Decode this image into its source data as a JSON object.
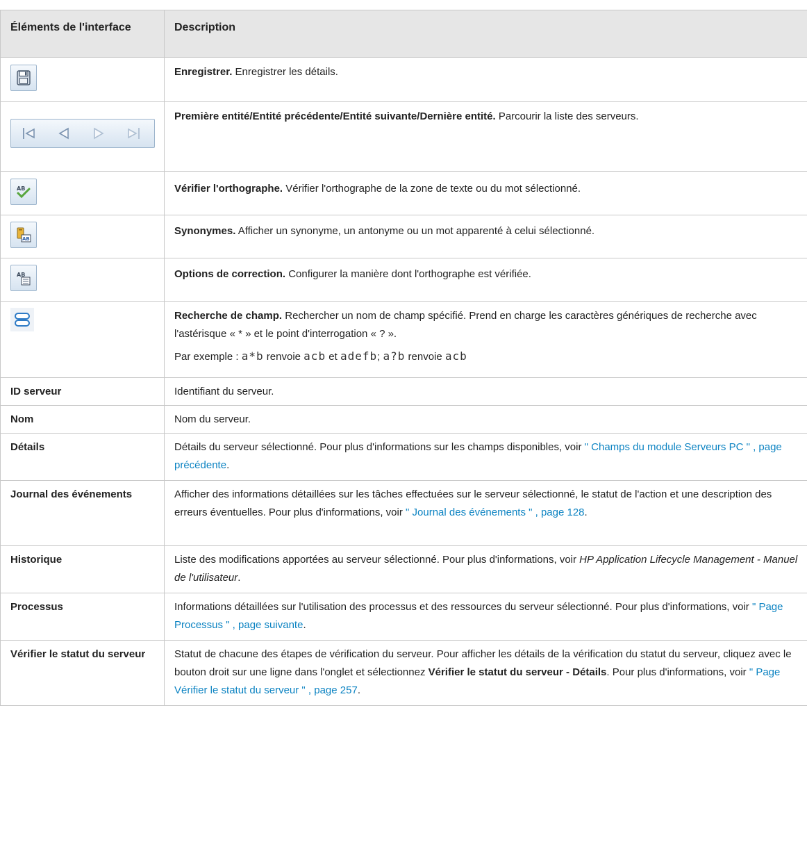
{
  "header": {
    "col1": "Éléments de l'interface",
    "col2": "Description"
  },
  "rows": [
    {
      "icon": "save-icon",
      "desc": {
        "bold": "Enregistrer.",
        "text": " Enregistrer les détails."
      }
    },
    {
      "icon": "navigation-arrows-icon",
      "desc": {
        "bold": "Première entité/Entité précédente/Entité suivante/Dernière entité.",
        "text": " Parcourir la liste des serveurs."
      }
    },
    {
      "icon": "spell-check-icon",
      "desc": {
        "bold": "Vérifier l'orthographe.",
        "text": " Vérifier l'orthographe de la zone de texte ou du mot sélectionné."
      }
    },
    {
      "icon": "thesaurus-icon",
      "desc": {
        "bold": "Synonymes.",
        "text": " Afficher un synonyme, un antonyme ou un mot apparenté à celui sélectionné."
      }
    },
    {
      "icon": "spelling-options-icon",
      "desc": {
        "bold": "Options de correction.",
        "text": " Configurer la manière dont l'orthographe est vérifiée."
      }
    },
    {
      "icon": "field-search-icon",
      "desc": {
        "bold": "Recherche de champ.",
        "text": " Rechercher un nom de champ spécifié. Prend en charge les caractères génériques de recherche avec l'astérisque « * » et le point d'interrogation « ? »."
      },
      "example": {
        "lead": "Par exemple : ",
        "c1": "a*b",
        "t1": " renvoie ",
        "c2": "acb",
        "t2": "  et ",
        "c3": "adefb",
        "t3": "; ",
        "c4": "a?b",
        "t4": " renvoie ",
        "c5": "acb"
      }
    },
    {
      "name": "ID serveur",
      "text": "Identifiant du serveur."
    },
    {
      "name": "Nom",
      "text": "Nom du serveur."
    },
    {
      "name": "Détails",
      "text": "Détails du serveur sélectionné. Pour plus d'informations sur les champs disponibles, voir ",
      "link": "\" Champs du module Serveurs PC \" , page précédente",
      "after": "."
    },
    {
      "name": "Journal des événements",
      "text": "Afficher des informations détaillées sur les tâches effectuées sur le serveur sélectionné, le statut de l'action et une description des erreurs éventuelles. Pour plus d'informations, voir ",
      "link": "\" Journal des événements \" , page 128",
      "after": "."
    },
    {
      "name": "Historique",
      "text": "Liste des modifications apportées au serveur sélectionné. Pour plus d'informations, voir ",
      "italic": "HP Application Lifecycle Management - Manuel de l'utilisateur",
      "after": "."
    },
    {
      "name": "Processus",
      "text": "Informations détaillées sur l'utilisation des processus et des ressources du serveur sélectionné. Pour plus d'informations, voir ",
      "link": "\" Page Processus \" , page suivante",
      "after": "."
    },
    {
      "name": "Vérifier le statut du serveur",
      "text": "Statut de chacune des étapes de vérification du serveur. Pour afficher les détails de la vérification du statut du serveur, cliquez avec le bouton droit sur une ligne dans l'onglet et sélectionnez ",
      "bold": "Vérifier le statut du serveur - Détails",
      "text2": ". Pour plus d'informations, voir ",
      "link": "\" Page Vérifier le statut du serveur \" , page 257",
      "after": "."
    }
  ],
  "colors": {
    "link": "#0c83c2",
    "header_bg": "#e6e6e6",
    "border": "#c8c8c8",
    "button_border": "#9cb4cc"
  }
}
